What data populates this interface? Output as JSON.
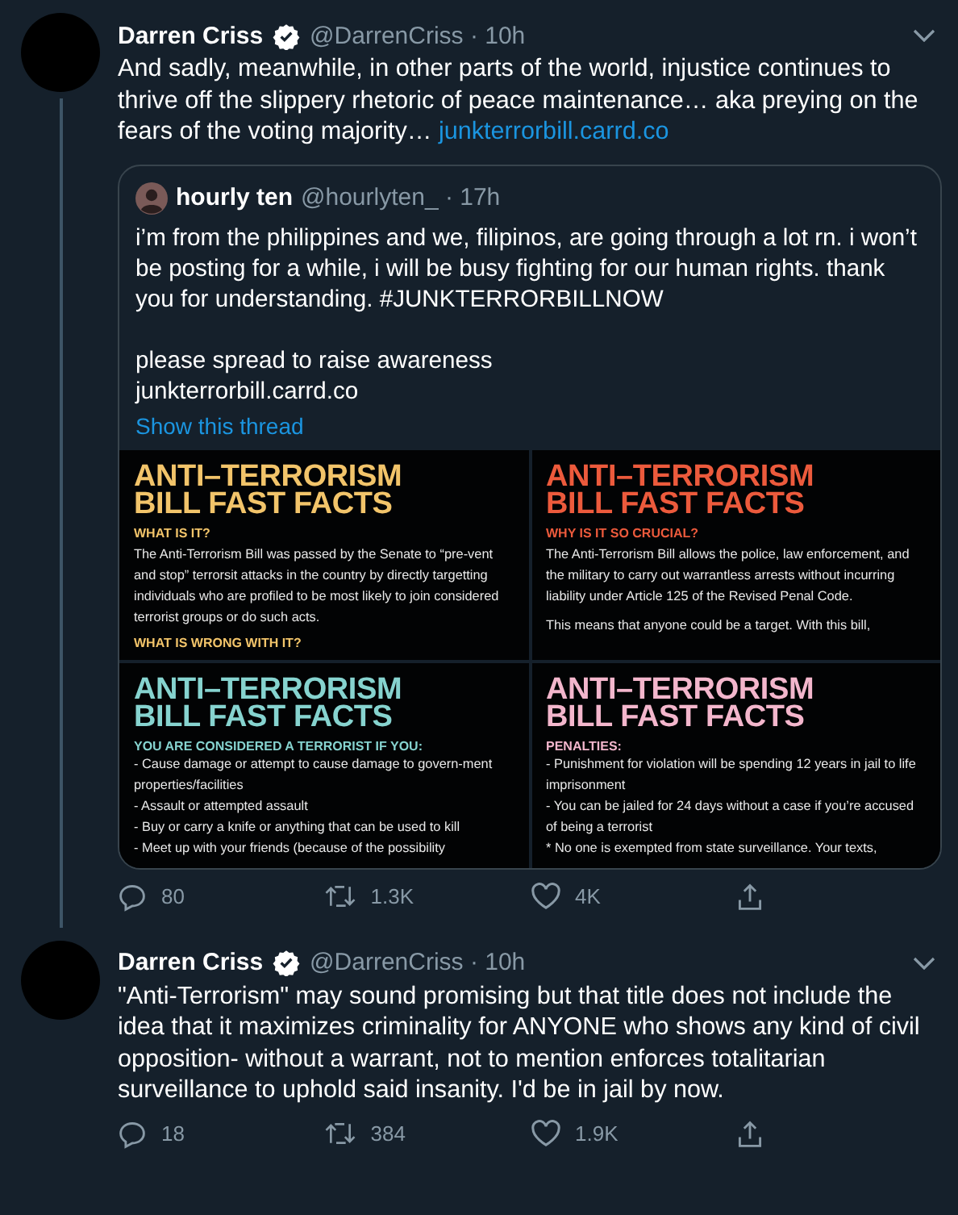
{
  "tweets": [
    {
      "author": "Darren Criss",
      "verified": true,
      "meta": "@DarrenCriss · 10h",
      "thread_line": true,
      "text": "And sadly, meanwhile, in other parts of the world, injustice continues to thrive off the slippery rhetoric of peace maintenance… aka preying on the fears of the voting majority…",
      "link": "junkterrorbill.carrd.co",
      "quote": {
        "author": "hourly ten",
        "meta": "@hourlyten_ · 17h",
        "text": "i’m from the philippines and we, filipinos, are going through a lot rn. i won’t be posting for a while, i will be busy fighting for our human rights. thank you for understanding. #JUNKTERRORBILLNOW\n\nplease spread to raise awareness\njunkterrorbill.carrd.co",
        "show_thread": "Show this thread",
        "images": [
          {
            "color": "#f2c46a",
            "title": [
              "ANTI–TERRORISM",
              "BILL FAST FACTS"
            ],
            "blocks": [
              {
                "kind": "heading",
                "text": "WHAT IS IT?"
              },
              {
                "kind": "text",
                "text": "The Anti-Terrorism Bill was passed by the Senate to “pre-vent and stop” terrorsit attacks in the country by directly targetting individuals who are profiled to be most likely to join considered terrorist groups or do such acts."
              },
              {
                "kind": "heading",
                "text": "WHAT IS WRONG WITH IT?"
              }
            ]
          },
          {
            "color": "#ec5a3c",
            "title": [
              "ANTI–TERRORISM",
              "BILL FAST FACTS"
            ],
            "blocks": [
              {
                "kind": "heading",
                "text": "WHY IS IT SO CRUCIAL?"
              },
              {
                "kind": "text",
                "text": "The Anti-Terrorism Bill allows the police, law enforcement, and the military to carry out warrantless arrests without incurring liability under Article 125 of the Revised Penal Code."
              },
              {
                "kind": "text",
                "text": "This means that anyone could be a target. With this bill,"
              }
            ]
          },
          {
            "color": "#86d3cf",
            "title": [
              "ANTI–TERRORISM",
              "BILL FAST FACTS"
            ],
            "blocks": [
              {
                "kind": "heading",
                "text": "YOU ARE CONSIDERED A TERRORIST IF YOU:"
              },
              {
                "kind": "line",
                "text": "- Cause damage or attempt to cause damage to govern-ment properties/facilities"
              },
              {
                "kind": "line",
                "text": "- Assault or attempted assault"
              },
              {
                "kind": "line",
                "text": "- Buy or carry a knife or anything that can be used to kill"
              },
              {
                "kind": "line",
                "text": "- Meet up with your friends (because of the possibility"
              }
            ]
          },
          {
            "color": "#f3b6cc",
            "title": [
              "ANTI–TERRORISM",
              "BILL FAST FACTS"
            ],
            "blocks": [
              {
                "kind": "heading",
                "text": "PENALTIES:"
              },
              {
                "kind": "line",
                "text": "- Punishment for violation will be spending 12 years in jail to life imprisonment"
              },
              {
                "kind": "line",
                "text": "- You can be jailed for 24 days without a case if you’re accused of being a terrorist"
              },
              {
                "kind": "line",
                "text": "* No one is exempted from state surveillance. Your texts,"
              }
            ]
          }
        ]
      },
      "actions": [
        {
          "kind": "reply",
          "count": "80"
        },
        {
          "kind": "retweet",
          "count": "1.3K"
        },
        {
          "kind": "like",
          "count": "4K"
        },
        {
          "kind": "share"
        }
      ]
    },
    {
      "author": "Darren Criss",
      "verified": true,
      "meta": "@DarrenCriss · 10h",
      "thread_line": false,
      "text": "\"Anti-Terrorism\" may sound promising but that title does not include the idea that it maximizes criminality for ANYONE who shows any kind of civil opposition- without a warrant, not to mention enforces totalitarian surveillance to uphold said insanity. I'd be in jail by now.",
      "actions": [
        {
          "kind": "reply",
          "count": "18"
        },
        {
          "kind": "retweet",
          "count": "384"
        },
        {
          "kind": "like",
          "count": "1.9K"
        },
        {
          "kind": "share"
        }
      ]
    }
  ]
}
